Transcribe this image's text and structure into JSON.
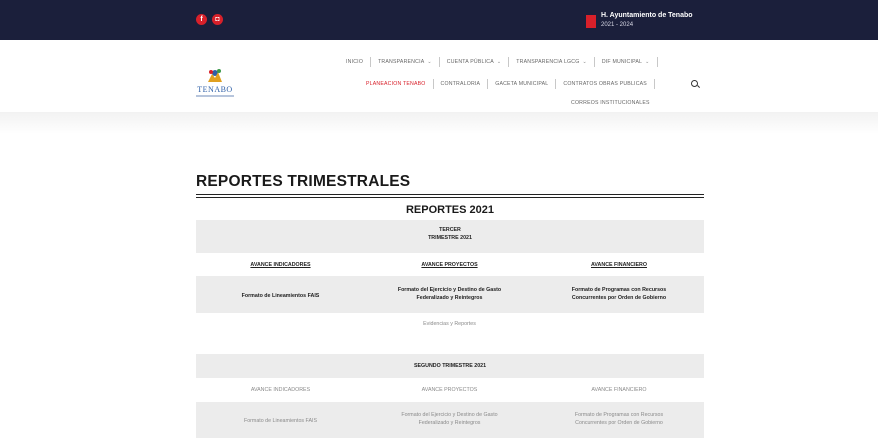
{
  "topbar": {
    "social": [
      "facebook-icon",
      "instagram-icon"
    ],
    "ayuntamiento_name": "H. Ayuntamiento de Tenabo",
    "ayuntamiento_years": "2021 - 2024"
  },
  "logo": {
    "text": "TENABO"
  },
  "nav": {
    "row1": [
      {
        "label": "INICIO",
        "dropdown": false
      },
      {
        "label": "TRANSPARENCIA",
        "dropdown": true
      },
      {
        "label": "CUENTA PÚBLICA",
        "dropdown": true
      },
      {
        "label": "TRANSPARENCIA LGCG",
        "dropdown": true
      },
      {
        "label": "DIF MUNICIPAL",
        "dropdown": true
      }
    ],
    "row2": [
      {
        "label": "PLANEACION TENABO",
        "active": true
      },
      {
        "label": "CONTRALORIA"
      },
      {
        "label": "GACETA MUNICIPAL"
      },
      {
        "label": "CONTRATOS OBRAS PUBLICAS"
      }
    ],
    "row3": [
      {
        "label": "CORREOS INSTITUCIONALES"
      }
    ]
  },
  "page": {
    "title": "REPORTES TRIMESTRALES",
    "year_heading": "REPORTES 2021"
  },
  "tercer": {
    "heading_line1": "TERCER",
    "heading_line2": "TRIMESTRE 2021",
    "col1_header": "AVANCE INDICADORES",
    "col2_header": "AVANCE PROYECTOS",
    "col3_header": "AVANCE FINANCIERO",
    "col1_link": "Formato de Lineamientos FAIS",
    "col2_link_line1": "Formato del Ejercicio y Destino de Gasto",
    "col2_link_line2": "Federalizado y Reintegros",
    "col3_link_line1": "Formato de Programas con Recursos",
    "col3_link_line2": "Concurrentes por Orden de Gobierno",
    "extra_link": "Evidencias y Reportes"
  },
  "segundo": {
    "heading": "SEGUNDO TRIMESTRE 2021",
    "col1_header": "AVANCE INDICADORES",
    "col2_header": "AVANCE PROYECTOS",
    "col3_header": "AVANCE FINANCIERO",
    "col1_link": "Formato de Lineamientos FAIS",
    "col2_link_line1": "Formato del Ejercicio y Destino de Gasto",
    "col2_link_line2": "Federalizado y Reintegros",
    "col3_link_line1": "Formato de Programas con Recursos",
    "col3_link_line2": "Concurrentes por Orden de Gobierno"
  },
  "colors": {
    "topbar": "#1b1f3b",
    "accent_red": "#d8202a",
    "band_gray": "#ececec"
  }
}
